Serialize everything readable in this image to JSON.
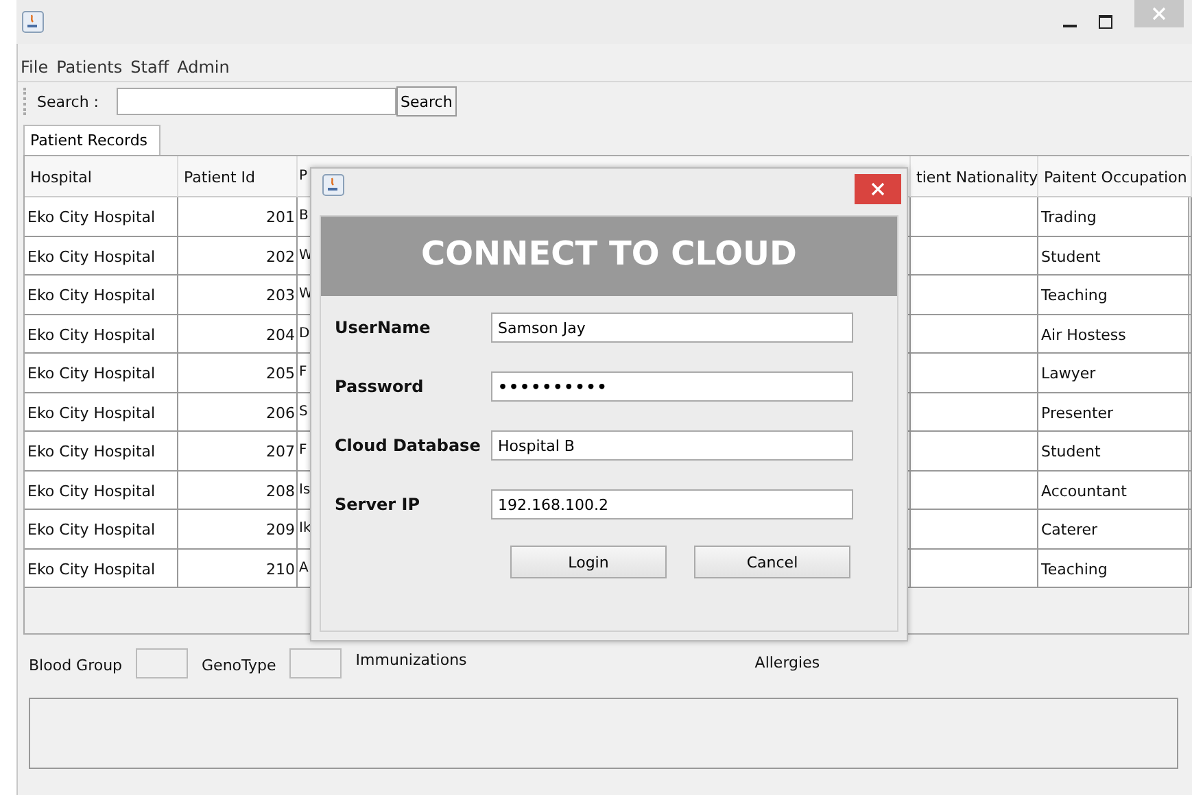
{
  "menu": [
    "File",
    "Patients",
    "Staff",
    "Admin"
  ],
  "toolbar": {
    "search_label": "Search :",
    "search_button": "Search"
  },
  "tabs": [
    {
      "label": "Patient Records",
      "selected": true
    }
  ],
  "table": {
    "columns": [
      "Hospital",
      "Patient Id",
      "P",
      "tient Nationality",
      "Paitent Occupation"
    ],
    "rows": [
      {
        "hospital": "Eko City Hospital",
        "patient_id": "201",
        "column_3": "B",
        "occupation": "Trading"
      },
      {
        "hospital": "Eko City Hospital",
        "patient_id": "202",
        "column_3": "W",
        "occupation": "Student"
      },
      {
        "hospital": "Eko City Hospital",
        "patient_id": "203",
        "column_3": "W",
        "occupation": "Teaching"
      },
      {
        "hospital": "Eko City Hospital",
        "patient_id": "204",
        "column_3": "D",
        "occupation": "Air Hostess"
      },
      {
        "hospital": "Eko City Hospital",
        "patient_id": "205",
        "column_3": "F",
        "occupation": "Lawyer"
      },
      {
        "hospital": "Eko City Hospital",
        "patient_id": "206",
        "column_3": "S",
        "occupation": "Presenter"
      },
      {
        "hospital": "Eko City Hospital",
        "patient_id": "207",
        "column_3": "F",
        "occupation": "Student"
      },
      {
        "hospital": "Eko City Hospital",
        "patient_id": "208",
        "column_3": "Is",
        "occupation": "Accountant"
      },
      {
        "hospital": "Eko City Hospital",
        "patient_id": "209",
        "column_3": "Ik",
        "occupation": "Caterer"
      },
      {
        "hospital": "Eko City Hospital",
        "patient_id": "210",
        "column_3": "A",
        "occupation": "Teaching"
      }
    ]
  },
  "details": {
    "blood_group_label": "Blood Group",
    "genotype_label": "GenoType",
    "immunizations_label": "Immunizations",
    "allergies_label": "Allergies"
  },
  "dialog": {
    "heading": "CONNECT TO CLOUD",
    "fields": [
      {
        "label": "UserName",
        "value": "Samson Jay",
        "kind": "text"
      },
      {
        "label": "Password",
        "value": "••••••••••",
        "kind": "password"
      },
      {
        "label": "Cloud Database",
        "value": "Hospital B",
        "kind": "text"
      },
      {
        "label": "Server IP",
        "value": "192.168.100.2",
        "kind": "text"
      }
    ],
    "buttons": [
      "Login",
      "Cancel"
    ]
  }
}
